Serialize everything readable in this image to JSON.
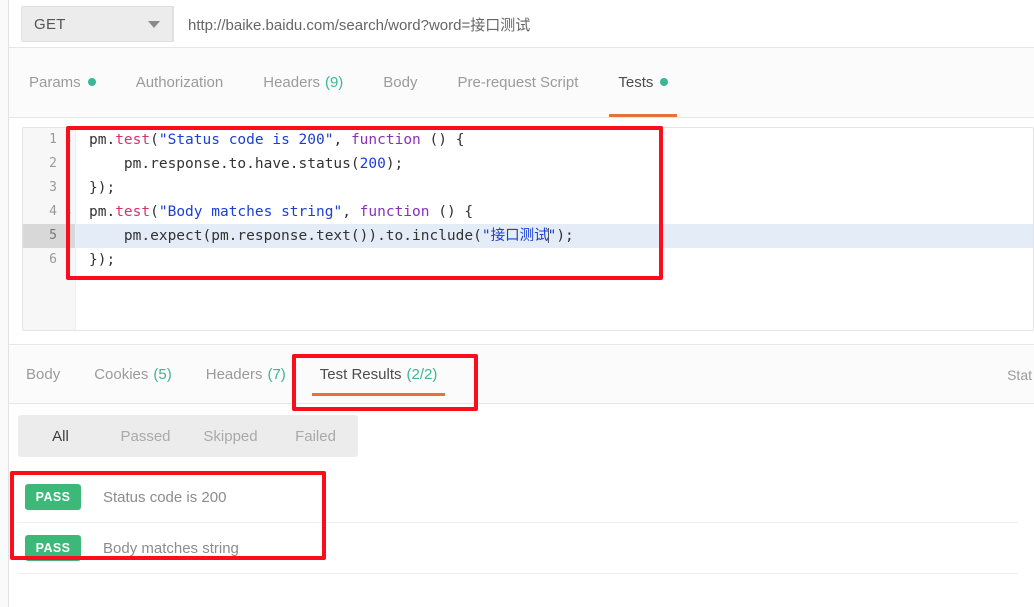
{
  "request": {
    "method": "GET",
    "method_caret": "chevron-down-icon",
    "url": "http://baike.baidu.com/search/word?word=接口测试"
  },
  "request_tabs": [
    {
      "label": "Params",
      "count": "",
      "dot": true,
      "active": false
    },
    {
      "label": "Authorization",
      "count": "",
      "dot": false,
      "active": false
    },
    {
      "label": "Headers",
      "count": "(9)",
      "dot": false,
      "active": false
    },
    {
      "label": "Body",
      "count": "",
      "dot": false,
      "active": false
    },
    {
      "label": "Pre-request Script",
      "count": "",
      "dot": false,
      "active": false
    },
    {
      "label": "Tests",
      "count": "",
      "dot": true,
      "active": true
    }
  ],
  "editor": {
    "gutter": [
      "1",
      "2",
      "3",
      "4",
      "5",
      "6"
    ],
    "active_line": 5,
    "fold_lines": [
      1,
      4
    ],
    "lines": [
      {
        "n": 1,
        "tokens": [
          {
            "t": "pm.",
            "c": "plain"
          },
          {
            "t": "test",
            "c": "fn"
          },
          {
            "t": "(",
            "c": "plain"
          },
          {
            "t": "\"Status code is 200\"",
            "c": "str"
          },
          {
            "t": ", ",
            "c": "plain"
          },
          {
            "t": "function",
            "c": "kw"
          },
          {
            "t": " () {",
            "c": "plain"
          }
        ]
      },
      {
        "n": 2,
        "tokens": [
          {
            "t": "    pm.response.to.have.status(",
            "c": "plain"
          },
          {
            "t": "200",
            "c": "num"
          },
          {
            "t": ");",
            "c": "plain"
          }
        ]
      },
      {
        "n": 3,
        "tokens": [
          {
            "t": "});",
            "c": "plain"
          }
        ]
      },
      {
        "n": 4,
        "tokens": [
          {
            "t": "pm.",
            "c": "plain"
          },
          {
            "t": "test",
            "c": "fn"
          },
          {
            "t": "(",
            "c": "plain"
          },
          {
            "t": "\"Body matches string\"",
            "c": "str"
          },
          {
            "t": ", ",
            "c": "plain"
          },
          {
            "t": "function",
            "c": "kw"
          },
          {
            "t": " () {",
            "c": "plain"
          }
        ]
      },
      {
        "n": 5,
        "tokens": [
          {
            "t": "    pm.expect(pm.response.text()).to.include(",
            "c": "plain"
          },
          {
            "t": "\"接口测试",
            "c": "str"
          },
          {
            "t": "CARET",
            "c": "caret"
          },
          {
            "t": "\"",
            "c": "str"
          },
          {
            "t": ");",
            "c": "plain"
          }
        ]
      },
      {
        "n": 6,
        "tokens": [
          {
            "t": "});",
            "c": "plain"
          }
        ]
      }
    ]
  },
  "response_tabs": [
    {
      "label": "Body",
      "count": "",
      "active": false
    },
    {
      "label": "Cookies",
      "count": "(5)",
      "active": false
    },
    {
      "label": "Headers",
      "count": "(7)",
      "active": false
    },
    {
      "label": "Test Results",
      "count": "(2/2)",
      "active": true
    }
  ],
  "response_status_clipped": "Stat",
  "filters": [
    {
      "label": "All",
      "active": true
    },
    {
      "label": "Passed",
      "active": false
    },
    {
      "label": "Skipped",
      "active": false
    },
    {
      "label": "Failed",
      "active": false
    }
  ],
  "test_results": [
    {
      "badge": "PASS",
      "name": "Status code is 200"
    },
    {
      "badge": "PASS",
      "name": "Body matches string"
    }
  ],
  "colors": {
    "accent_orange": "#e8703a",
    "pass_green": "#3cb878",
    "count_green": "#3ab795",
    "annotation_red": "#fc0d1b",
    "active_line_blue": "#e3ecf7"
  }
}
